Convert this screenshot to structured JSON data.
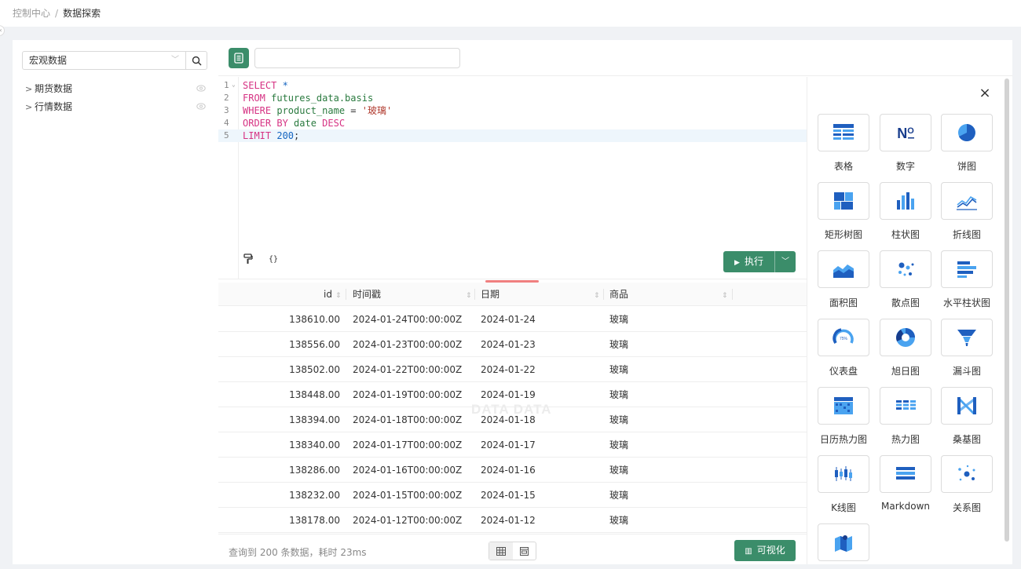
{
  "breadcrumb": {
    "root": "控制中心",
    "separator": "/",
    "current": "数据探索"
  },
  "left": {
    "database": "宏观数据",
    "tree": [
      {
        "label": "期货数据"
      },
      {
        "label": "行情数据"
      }
    ]
  },
  "editor": {
    "query_name": "",
    "lines": [
      {
        "num": "1",
        "parts": [
          {
            "t": "SELECT ",
            "c": "kw"
          },
          {
            "t": "*",
            "c": "numv"
          }
        ]
      },
      {
        "num": "2",
        "parts": [
          {
            "t": "FROM ",
            "c": "kw"
          },
          {
            "t": "futures_data.basis",
            "c": "id"
          }
        ]
      },
      {
        "num": "3",
        "parts": [
          {
            "t": "WHERE ",
            "c": "kw"
          },
          {
            "t": "product_name",
            "c": "id"
          },
          {
            "t": " = ",
            "c": "op"
          },
          {
            "t": "'玻璃'",
            "c": "str"
          }
        ]
      },
      {
        "num": "4",
        "parts": [
          {
            "t": "ORDER BY ",
            "c": "kw"
          },
          {
            "t": "date ",
            "c": "id"
          },
          {
            "t": "DESC",
            "c": "kw"
          }
        ]
      },
      {
        "num": "5",
        "parts": [
          {
            "t": "LIMIT ",
            "c": "kw"
          },
          {
            "t": "200",
            "c": "numv"
          },
          {
            "t": ";",
            "c": "op"
          }
        ]
      }
    ],
    "run_label": "执行"
  },
  "table": {
    "columns": [
      "id",
      "时间戳",
      "日期",
      "商品"
    ],
    "rows": [
      [
        "138610.00",
        "2024-01-24T00:00:00Z",
        "2024-01-24",
        "玻璃"
      ],
      [
        "138556.00",
        "2024-01-23T00:00:00Z",
        "2024-01-23",
        "玻璃"
      ],
      [
        "138502.00",
        "2024-01-22T00:00:00Z",
        "2024-01-22",
        "玻璃"
      ],
      [
        "138448.00",
        "2024-01-19T00:00:00Z",
        "2024-01-19",
        "玻璃"
      ],
      [
        "138394.00",
        "2024-01-18T00:00:00Z",
        "2024-01-18",
        "玻璃"
      ],
      [
        "138340.00",
        "2024-01-17T00:00:00Z",
        "2024-01-17",
        "玻璃"
      ],
      [
        "138286.00",
        "2024-01-16T00:00:00Z",
        "2024-01-16",
        "玻璃"
      ],
      [
        "138232.00",
        "2024-01-15T00:00:00Z",
        "2024-01-15",
        "玻璃"
      ],
      [
        "138178.00",
        "2024-01-12T00:00:00Z",
        "2024-01-12",
        "玻璃"
      ]
    ]
  },
  "watermark": "DATA DATA",
  "footer": {
    "status": "查询到 200 条数据，耗时 23ms",
    "viz_label": "可视化"
  },
  "charts": [
    {
      "label": "表格",
      "icon": "table-chart-icon"
    },
    {
      "label": "数字",
      "icon": "number-chart-icon"
    },
    {
      "label": "饼图",
      "icon": "pie-chart-icon"
    },
    {
      "label": "矩形树图",
      "icon": "treemap-chart-icon"
    },
    {
      "label": "柱状图",
      "icon": "bar-chart-icon"
    },
    {
      "label": "折线图",
      "icon": "line-chart-icon"
    },
    {
      "label": "面积图",
      "icon": "area-chart-icon"
    },
    {
      "label": "散点图",
      "icon": "scatter-chart-icon"
    },
    {
      "label": "水平柱状图",
      "icon": "horizontal-bar-chart-icon"
    },
    {
      "label": "仪表盘",
      "icon": "gauge-chart-icon"
    },
    {
      "label": "旭日图",
      "icon": "sunburst-chart-icon"
    },
    {
      "label": "漏斗图",
      "icon": "funnel-chart-icon"
    },
    {
      "label": "日历热力图",
      "icon": "calendar-heatmap-icon"
    },
    {
      "label": "热力图",
      "icon": "heatmap-chart-icon"
    },
    {
      "label": "桑基图",
      "icon": "sankey-chart-icon"
    },
    {
      "label": "K线图",
      "icon": "candlestick-chart-icon"
    },
    {
      "label": "Markdown",
      "icon": "markdown-icon"
    },
    {
      "label": "关系图",
      "icon": "graph-chart-icon"
    },
    {
      "label": "",
      "icon": "map-chart-icon"
    }
  ],
  "colors": {
    "accent": "#3b8d6a",
    "icon_blue": "#1f5fbf",
    "icon_light": "#4aa3f0"
  }
}
